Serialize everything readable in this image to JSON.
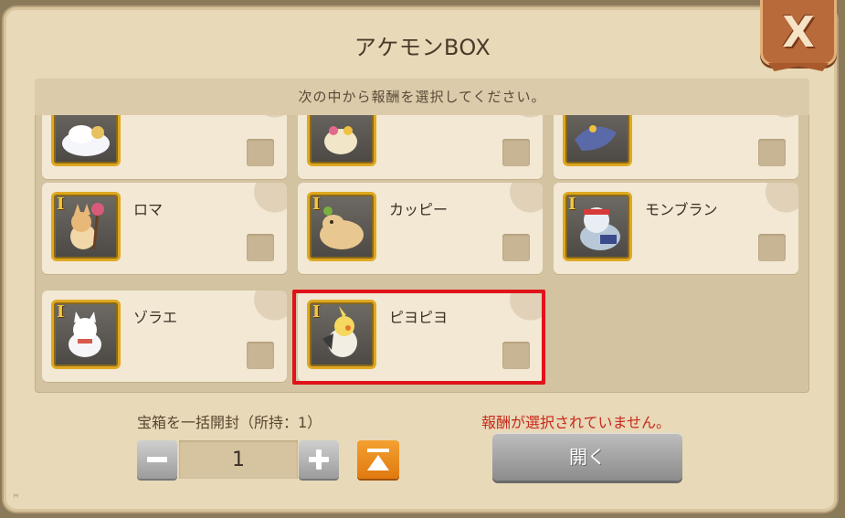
{
  "dialog": {
    "title": "アケモンBOX",
    "close_label": "X",
    "subtitle": "次の中から報酬を選択してください。"
  },
  "rewards": [
    {
      "name": "",
      "rank": "",
      "selected": false,
      "icon": "white-fluffy-cloud-creature-icon"
    },
    {
      "name": "",
      "rank": "",
      "selected": false,
      "icon": "flower-creature-icon"
    },
    {
      "name": "",
      "rank": "",
      "selected": false,
      "icon": "blue-dragon-creature-icon"
    },
    {
      "name": "ロマ",
      "rank": "I",
      "selected": false,
      "icon": "fox-with-flower-staff-icon"
    },
    {
      "name": "カッピー",
      "rank": "I",
      "selected": false,
      "icon": "capybara-icon"
    },
    {
      "name": "モンブラン",
      "rank": "I",
      "selected": false,
      "icon": "seal-with-headband-icon"
    },
    {
      "name": "ゾラエ",
      "rank": "I",
      "selected": false,
      "icon": "white-cat-with-ribbon-icon"
    },
    {
      "name": "ピヨピヨ",
      "rank": "I",
      "selected": false,
      "icon": "cockatiel-bird-icon",
      "highlighted": true
    }
  ],
  "batch": {
    "label": "宝箱を一括開封（所持：1）",
    "quantity": "1"
  },
  "warning": "報酬が選択されていません。",
  "open_button": "開く",
  "colors": {
    "highlight": "#e0121a",
    "warning_text": "#c8281a",
    "max_button": "#f09020",
    "close_button": "#b86a3a"
  }
}
